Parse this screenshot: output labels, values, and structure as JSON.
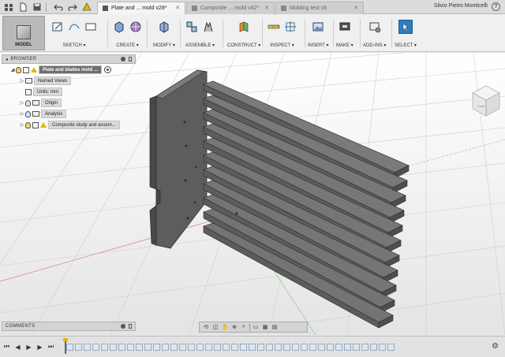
{
  "titlebar": {
    "tabs": [
      {
        "label": "Plate and ... mold v28*",
        "active": true
      },
      {
        "label": "Composite ... mold v42*",
        "active": false
      },
      {
        "label": "Molding test v8",
        "active": false
      }
    ],
    "user_name": "Silvio Pietro Monticelli",
    "help": "?"
  },
  "ribbon": {
    "workspace": "MODEL",
    "groups": [
      {
        "label": "SKETCH ▾"
      },
      {
        "label": "CREATE ▾"
      },
      {
        "label": "MODIFY ▾"
      },
      {
        "label": "ASSEMBLE ▾"
      },
      {
        "label": "CONSTRUCT ▾"
      },
      {
        "label": "INSPECT ▾"
      },
      {
        "label": "INSERT ▾"
      },
      {
        "label": "MAKE ▾"
      },
      {
        "label": "ADD-INS ▾"
      },
      {
        "label": "SELECT ▾"
      }
    ]
  },
  "browser": {
    "title": "BROWSER",
    "root": "Plate and blades mold ...",
    "items": [
      {
        "label": "Named Views"
      },
      {
        "label": "Units: mm"
      },
      {
        "label": "Origin"
      },
      {
        "label": "Analysis"
      },
      {
        "label": "Composite study and assem..."
      }
    ]
  },
  "comments": {
    "title": "COMMENTS"
  },
  "viewcube": {
    "face_label": "Front"
  },
  "colors": {
    "accent_select": "#2f7fbf",
    "part_gray": "#6b6b6b",
    "warning": "#e8b400",
    "grid": "#c9c9c9"
  }
}
